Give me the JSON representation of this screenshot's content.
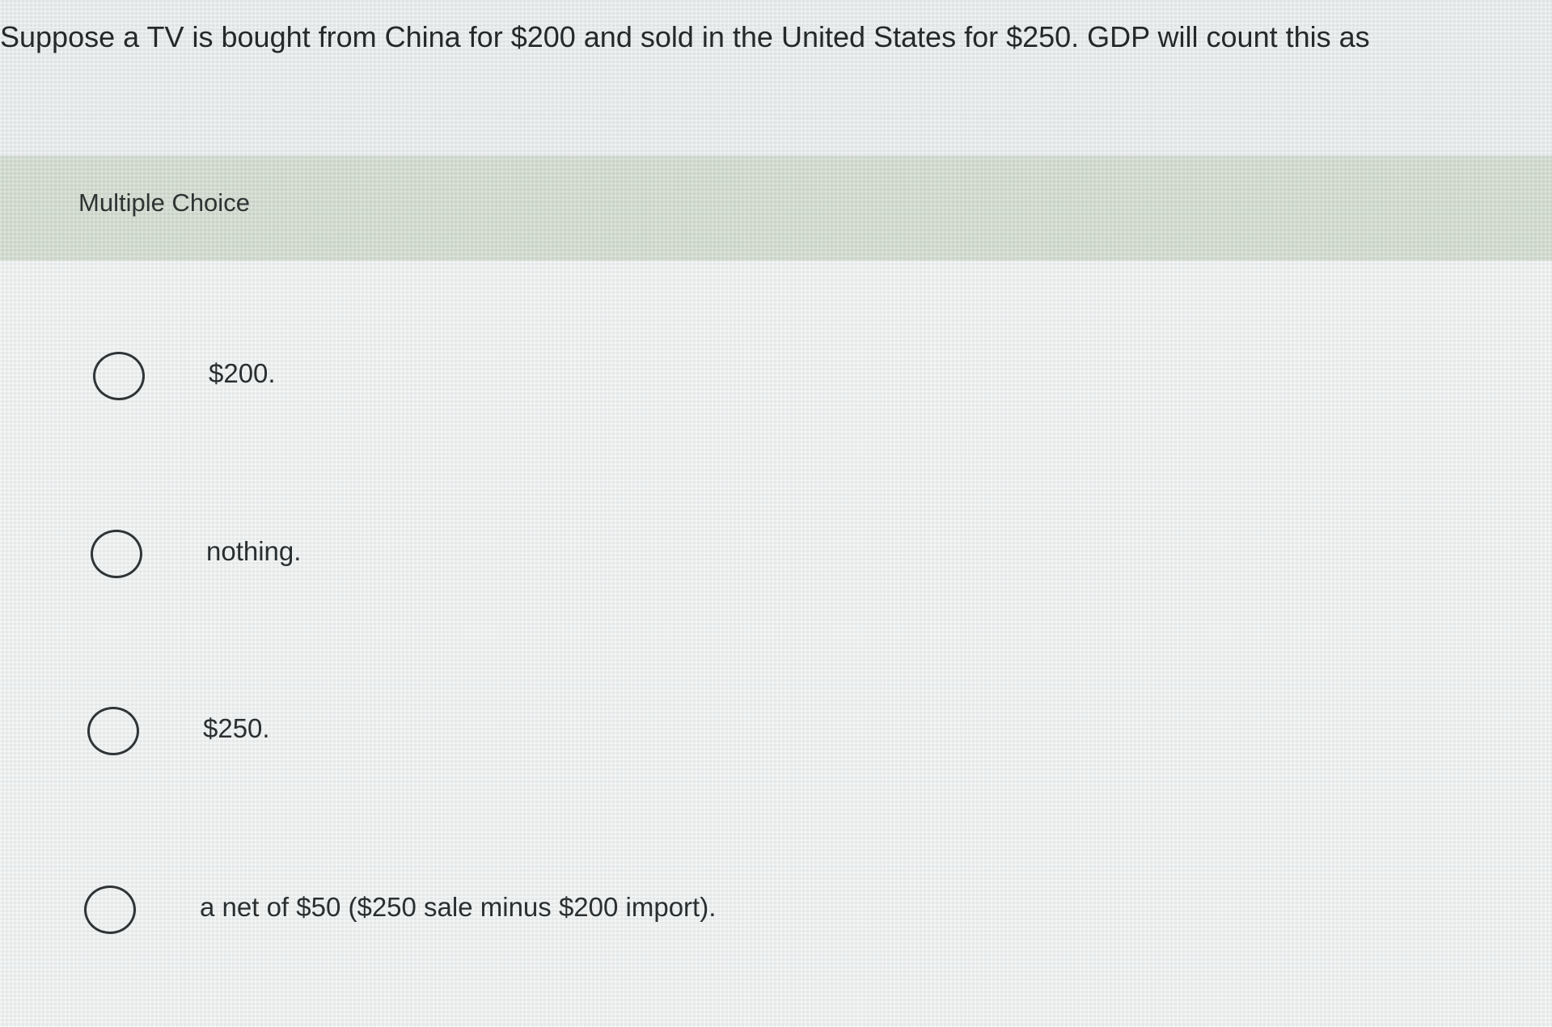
{
  "question": {
    "text": "Suppose a TV is bought from China for $200 and sold in the United States for $250. GDP will count this as"
  },
  "section": {
    "label": "Multiple Choice"
  },
  "options": [
    {
      "label": "$200."
    },
    {
      "label": "nothing."
    },
    {
      "label": "$250."
    },
    {
      "label": "a net of $50 ($250 sale minus $200 import)."
    }
  ],
  "icons": {
    "radio": "radio-unchecked-icon"
  },
  "colors": {
    "header_band": "#c9d3c7",
    "background": "#e5e8e8",
    "text": "#2a2f31"
  }
}
